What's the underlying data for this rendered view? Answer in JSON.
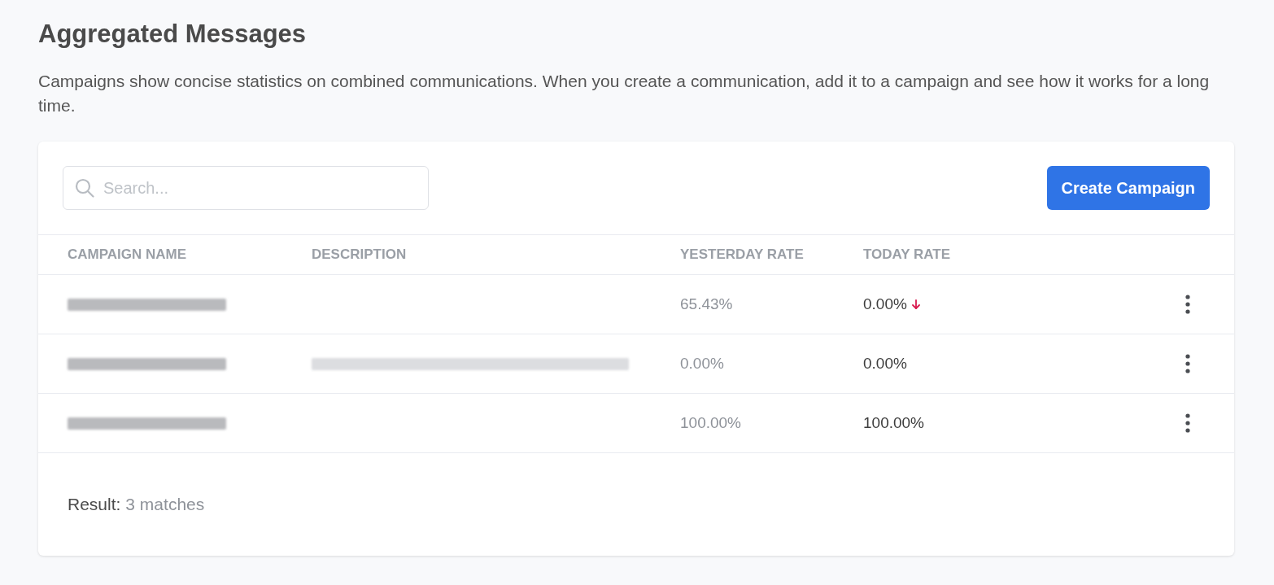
{
  "page": {
    "title": "Aggregated Messages",
    "description": "Campaigns show concise statistics on combined communications. When you create a communication, add it to a campaign and see how it works for a long time."
  },
  "toolbar": {
    "search": {
      "placeholder": "Search..."
    },
    "create_button": "Create Campaign"
  },
  "table": {
    "columns": [
      "CAMPAIGN NAME",
      "DESCRIPTION",
      "YESTERDAY RATE",
      "TODAY RATE"
    ],
    "rows": [
      {
        "campaign_name": {
          "kind": "blurred"
        },
        "yesterday_rate": "65.43%",
        "today_rate": "0.00%",
        "rate_dropped": true
      },
      {
        "campaign_name": {
          "kind": "blurred"
        },
        "description": {
          "kind": "blurred"
        },
        "yesterday_rate": "0.00%",
        "today_rate": "0.00%",
        "rate_dropped": false
      },
      {
        "campaign_name": {
          "kind": "blurred"
        },
        "yesterday_rate": "100.00%",
        "today_rate": "100.00%",
        "rate_dropped": false
      }
    ]
  },
  "footer": {
    "label": "Result:",
    "count": "3 matches"
  }
}
